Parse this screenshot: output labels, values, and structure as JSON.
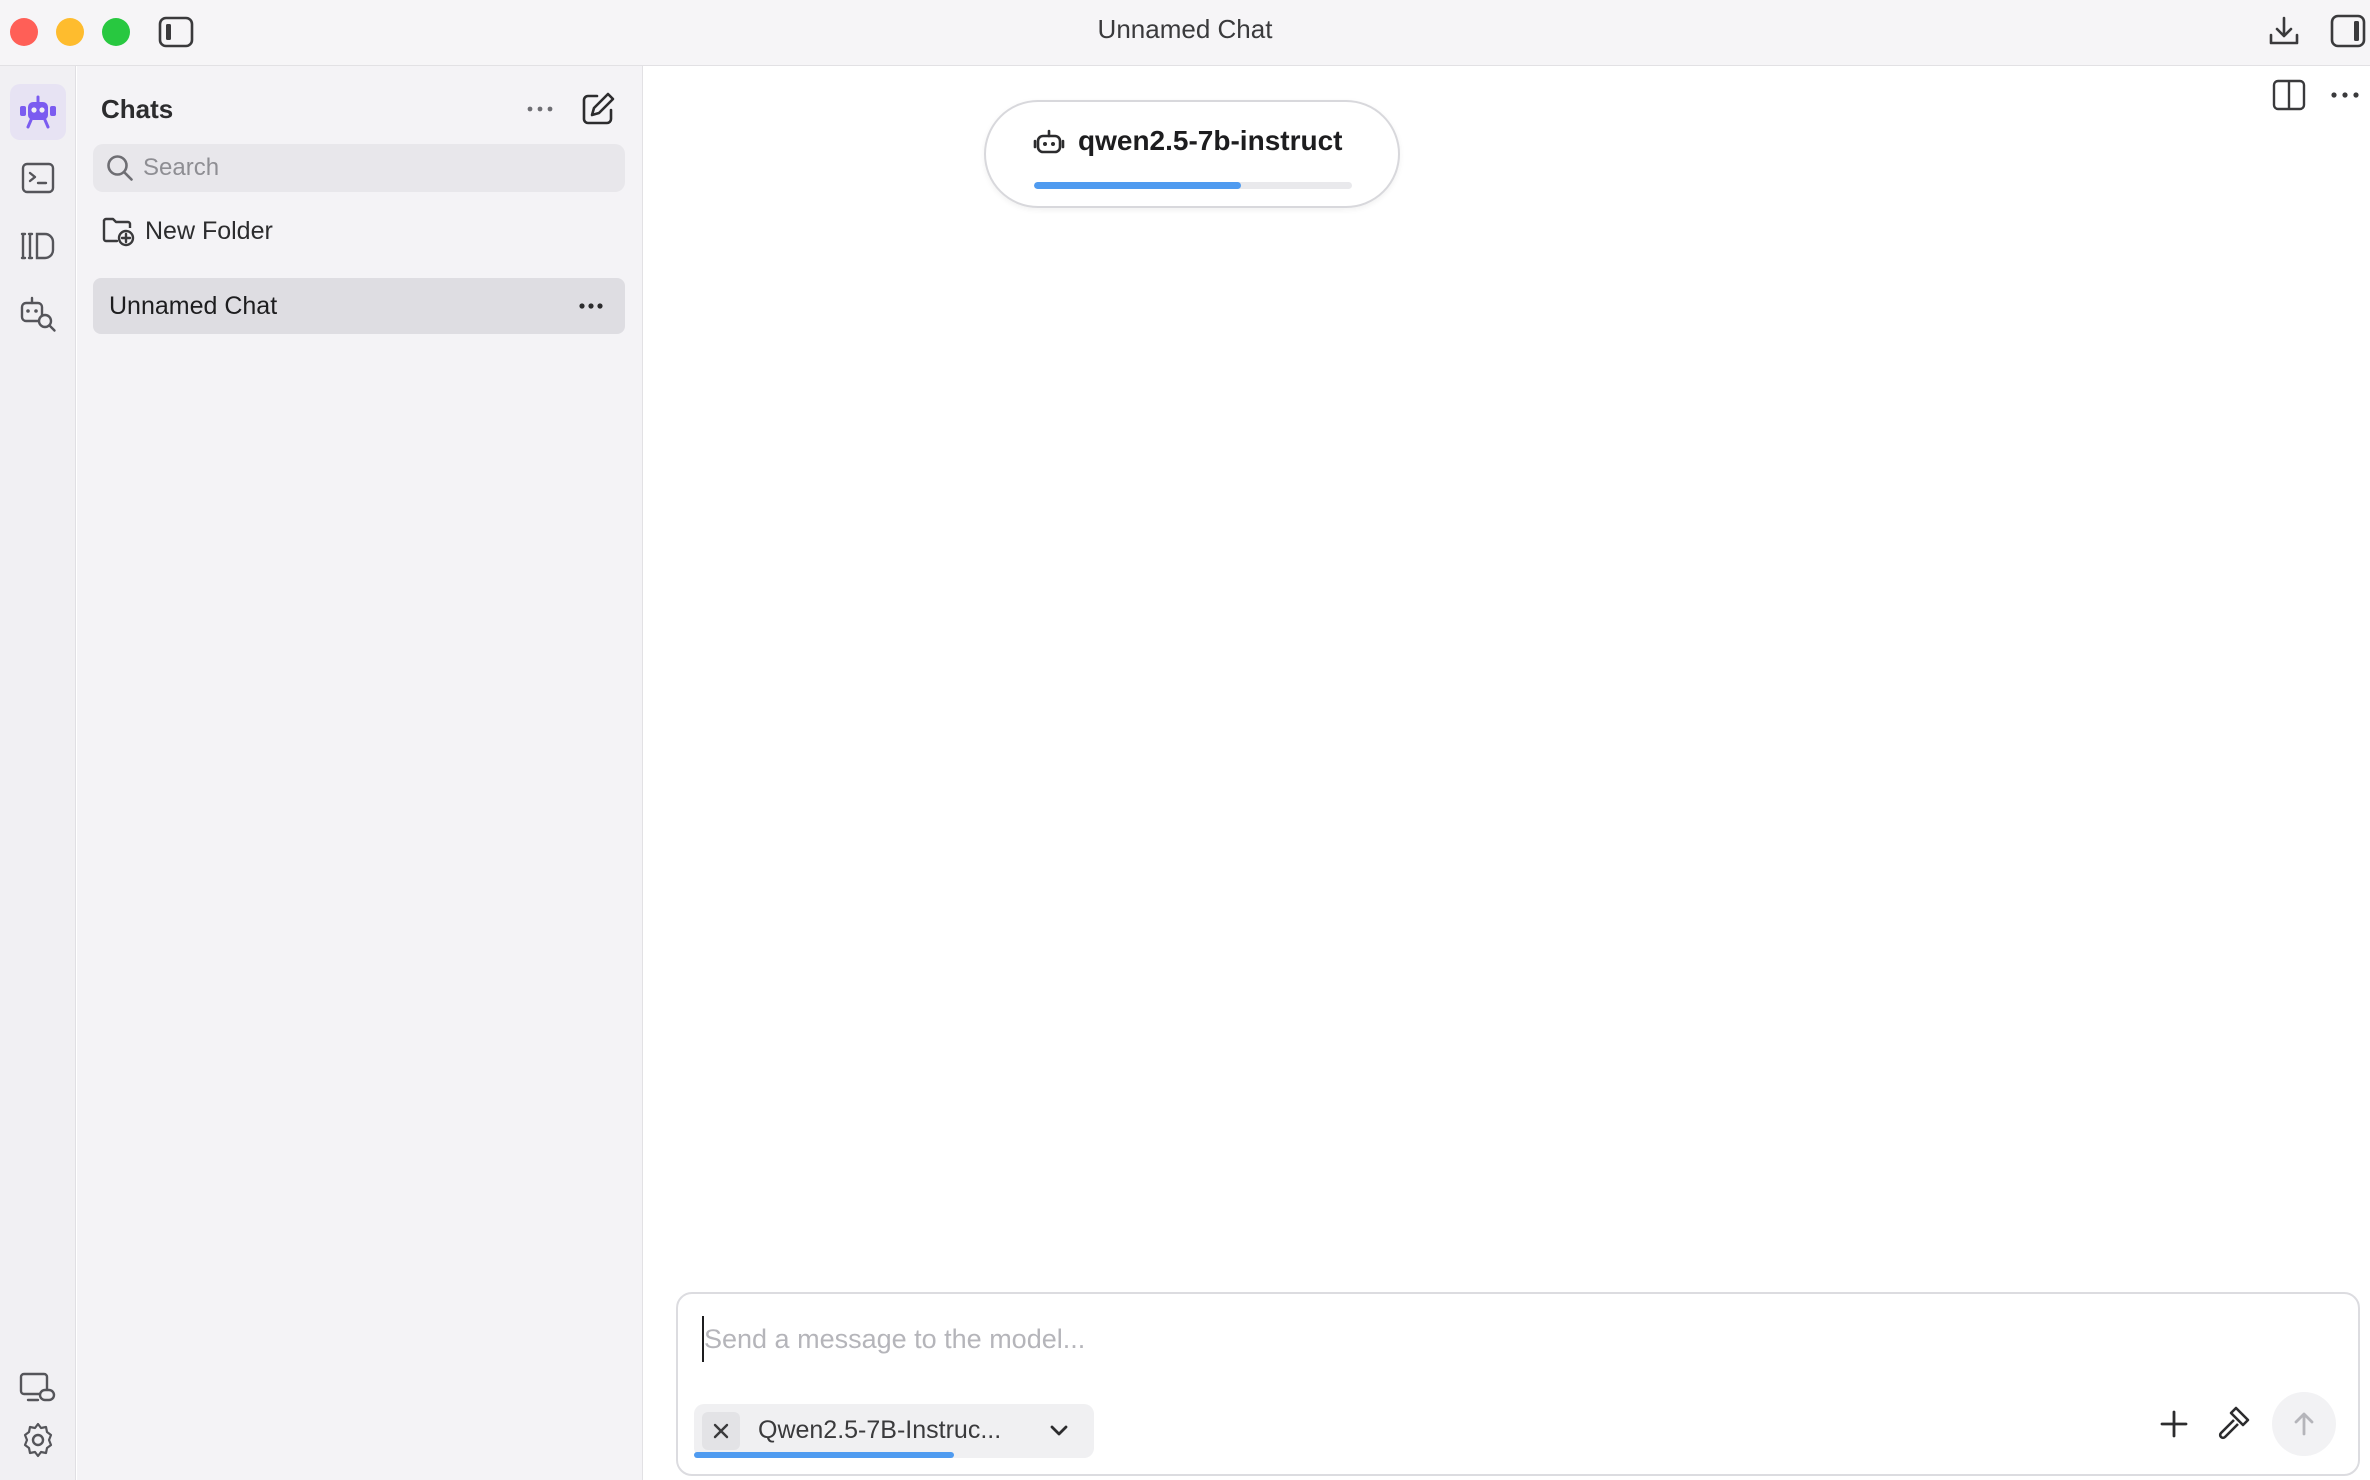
{
  "window": {
    "title": "Unnamed Chat"
  },
  "titlebar": {
    "icons": [
      "close-traffic-light",
      "minimize-traffic-light",
      "zoom-traffic-light",
      "sidebar-toggle-icon",
      "download-icon",
      "right-panel-icon"
    ]
  },
  "rail": {
    "items": [
      {
        "icon": "assistant-robot-icon",
        "active": true
      },
      {
        "icon": "terminal-icon",
        "active": false
      },
      {
        "icon": "library-icon",
        "active": false
      },
      {
        "icon": "model-search-icon",
        "active": false
      }
    ],
    "bottom": [
      {
        "icon": "remote-connect-icon"
      },
      {
        "icon": "gear-icon"
      }
    ]
  },
  "sidebar": {
    "title": "Chats",
    "search_placeholder": "Search",
    "new_folder_label": "New Folder",
    "chats": [
      {
        "label": "Unnamed Chat",
        "selected": true
      }
    ]
  },
  "main": {
    "model_pill": {
      "name": "qwen2.5-7b-instruct",
      "loading_progress": 0.65
    },
    "composer": {
      "placeholder": "Send a message to the model...",
      "model_chip": {
        "label": "Qwen2.5-7B-Instruc...",
        "loading_progress": 0.65
      }
    }
  },
  "colors": {
    "accent": "#7b5cf0",
    "progress": "#4f9bf0",
    "traffic_red": "#ff5f57",
    "traffic_yellow": "#febc2e",
    "traffic_green": "#28c840"
  }
}
